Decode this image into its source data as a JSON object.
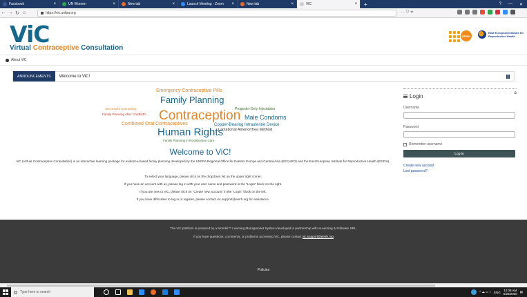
{
  "browser": {
    "tabs": [
      {
        "label": "Facebook",
        "color": "#3b5998"
      },
      {
        "label": "UN Women",
        "color": "#2ea44f"
      },
      {
        "label": "New tab",
        "color": "#e9682a"
      },
      {
        "label": "Launch Meeting - Zoom",
        "color": "#2d8cff"
      },
      {
        "label": "New tab",
        "color": "#e9682a"
      },
      {
        "label": "ViC",
        "color": "#cccccc"
      }
    ],
    "new_tab_symbol": "+",
    "window_controls": [
      "?",
      "—",
      "✕"
    ],
    "url": "https://vic.unfpa.org",
    "url_actions": "··· ⛉ ☆"
  },
  "site": {
    "logo_text": "ViC",
    "subtitle_prefix": "Virtual ",
    "subtitle_highlight": "Contraceptive",
    "subtitle_suffix": " Consultation",
    "partner_badge": "EEIRH",
    "partner2_text": "East European Institute for Reproductive Health"
  },
  "crumb": {
    "label": "About ViC"
  },
  "announcements": {
    "label": "ANNOUNCEMENTS",
    "text": "Welcome to ViC!"
  },
  "cloud": [
    {
      "t": "Emergency Contraceptive Pills",
      "c": "#e0862a"
    },
    {
      "t": "Family Planning",
      "c": "#16678e"
    },
    {
      "t": "Successful Counseling",
      "c": "#e0862a"
    },
    {
      "t": "Progestin-Only Injectables",
      "c": "#3d6e2e"
    },
    {
      "t": "Family Planning After Childbirth",
      "c": "#c0392b"
    },
    {
      "t": "Contraception",
      "c": "#e0862a"
    },
    {
      "t": "Male Condoms",
      "c": "#16678e"
    },
    {
      "t": "Combined Oral Contraceptives",
      "c": "#e0862a"
    },
    {
      "t": "Copper-Bearing Intrauterine Device",
      "c": "#16678e"
    },
    {
      "t": "Human Rights",
      "c": "#16678e"
    },
    {
      "t": "Lactational Amenorrhea Method",
      "c": "#333333"
    },
    {
      "t": "Family Planning in Postabortion Care",
      "c": "#3d6e2e"
    }
  ],
  "main": {
    "welcome_title": "Welcome to ViC!",
    "intro": "ViC (Virtual Contraceptive Consultation) is an interactive learning package for evidence-based family planning developed by the UNFPA Regional Office for Eastern Europe and Central Asia (EECARO) and the East European Institute for Reproductive Health (EEIRH).",
    "p1": "To select your language, please click on the dropdown list on the upper right corner.",
    "p2": "If you have an account with us, please log in with your user name and password in the \"Login\" block on the right.",
    "p3": "If you are new to ViC, please click on \"Create new account\" in the \"Login\" block on the left.",
    "p4": "If you have difficulties to log in or register, please contact vic.support@eeirh.org for assistance."
  },
  "login": {
    "title": "Login",
    "username_label": "Username",
    "password_label": "Password",
    "remember_label": "Remember username",
    "button_label": "Log in",
    "create_account": "Create new account",
    "forgot_password": "Lost password?"
  },
  "footer": {
    "line1": "The ViC platform is powered by a Moodle™ Learning Management System developed in partnership with eLearning & Software SRL.",
    "line2_prefix": "If you have questions, comments, or problems accessing ViC, please contact ",
    "line2_email": "vic.support@eeirh.org",
    "policies": "Policies"
  },
  "taskbar": {
    "search_placeholder": "Type here to search",
    "lang": "ENG",
    "time": "10:08 AM",
    "date": "5/29/2020"
  }
}
